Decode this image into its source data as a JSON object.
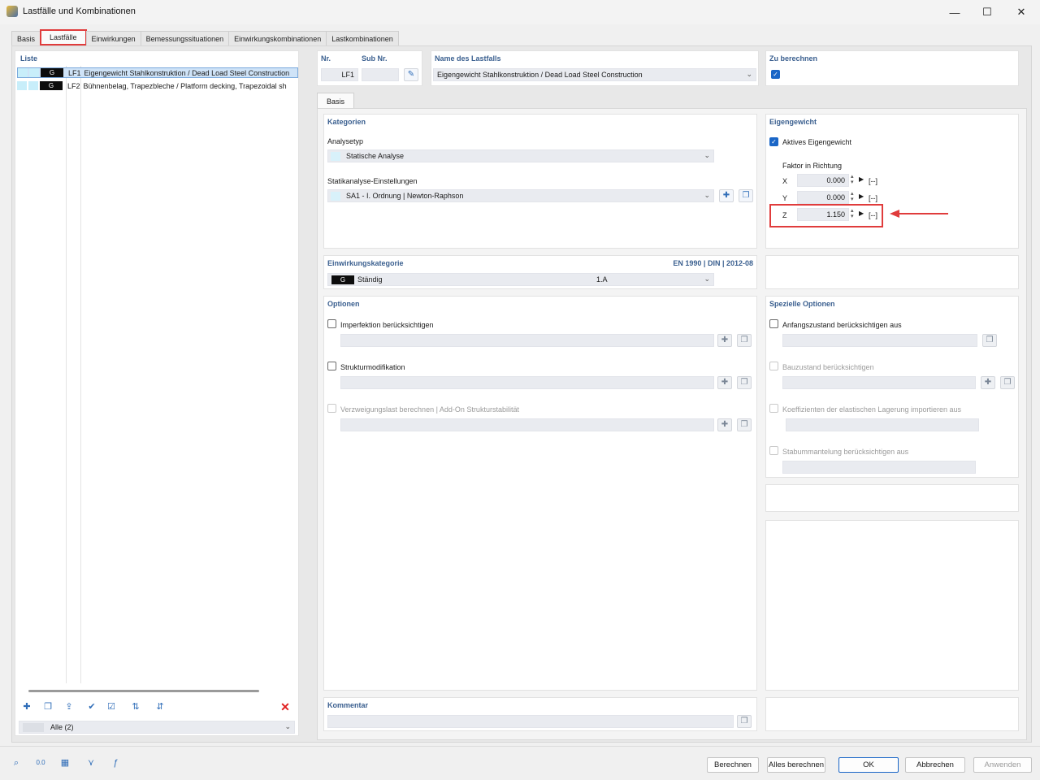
{
  "window": {
    "title": "Lastfälle und Kombinationen",
    "minimize": "—",
    "maximize": "☐",
    "close": "✕"
  },
  "tabs": [
    "Basis",
    "Lastfälle",
    "Einwirkungen",
    "Bemessungssituationen",
    "Einwirkungskombinationen",
    "Lastkombinationen"
  ],
  "active_tab": "Lastfälle",
  "list": {
    "title": "Liste",
    "items": [
      {
        "cat": "G",
        "id": "LF1",
        "name": "Eigengewicht Stahlkonstruktion / Dead Load Steel Construction"
      },
      {
        "cat": "G",
        "id": "LF2",
        "name": "Bühnenbelag, Trapezbleche / Platform decking, Trapezoidal sh"
      }
    ],
    "filter": "Alle (2)"
  },
  "header": {
    "nr_label": "Nr.",
    "nr_value": "LF1",
    "sub_label": "Sub Nr.",
    "sub_value": "",
    "name_label": "Name des Lastfalls",
    "name_value": "Eigengewicht Stahlkonstruktion / Dead Load Steel Construction",
    "calc_label": "Zu berechnen",
    "calc_checked": true
  },
  "subtab": "Basis",
  "kategorien": {
    "title": "Kategorien",
    "analysetyp_label": "Analysetyp",
    "analysetyp_value": "Statische Analyse",
    "stat_label": "Statikanalyse-Einstellungen",
    "stat_value": "SA1 - I. Ordnung | Newton-Raphson"
  },
  "eigengewicht": {
    "title": "Eigengewicht",
    "active_label": "Aktives Eigengewicht",
    "active_checked": true,
    "factor_label": "Faktor in Richtung",
    "rows": [
      {
        "axis": "X",
        "value": "0.000",
        "unit": "[--]"
      },
      {
        "axis": "Y",
        "value": "0.000",
        "unit": "[--]"
      },
      {
        "axis": "Z",
        "value": "1.150",
        "unit": "[--]"
      }
    ]
  },
  "einwirkung": {
    "title": "Einwirkungskategorie",
    "norm": "EN 1990 | DIN | 2012-08",
    "cat": "G",
    "value": "Ständig",
    "code": "1.A"
  },
  "optionen": {
    "title": "Optionen",
    "items": [
      {
        "label": "Imperfektion berücksichtigen",
        "enabled": true
      },
      {
        "label": "Strukturmodifikation",
        "enabled": true
      },
      {
        "label": "Verzweigungslast berechnen | Add-On Strukturstabilität",
        "enabled": false
      }
    ]
  },
  "spezielle": {
    "title": "Spezielle Optionen",
    "items": [
      {
        "label": "Anfangszustand berücksichtigen aus",
        "enabled": true
      },
      {
        "label": "Bauzustand berücksichtigen",
        "enabled": false
      },
      {
        "label": "Koeffizienten der elastischen Lagerung importieren aus",
        "enabled": false
      },
      {
        "label": "Stabummantelung berücksichtigen aus",
        "enabled": false
      }
    ]
  },
  "kommentar": {
    "title": "Kommentar"
  },
  "footer": {
    "berechnen": "Berechnen",
    "alles": "Alles berechnen",
    "ok": "OK",
    "abbrechen": "Abbrechen",
    "anwenden": "Anwenden"
  },
  "colors": {
    "accent": "#3a5f8f",
    "highlight": "#e03c3c",
    "checkbox": "#1a66c7"
  }
}
